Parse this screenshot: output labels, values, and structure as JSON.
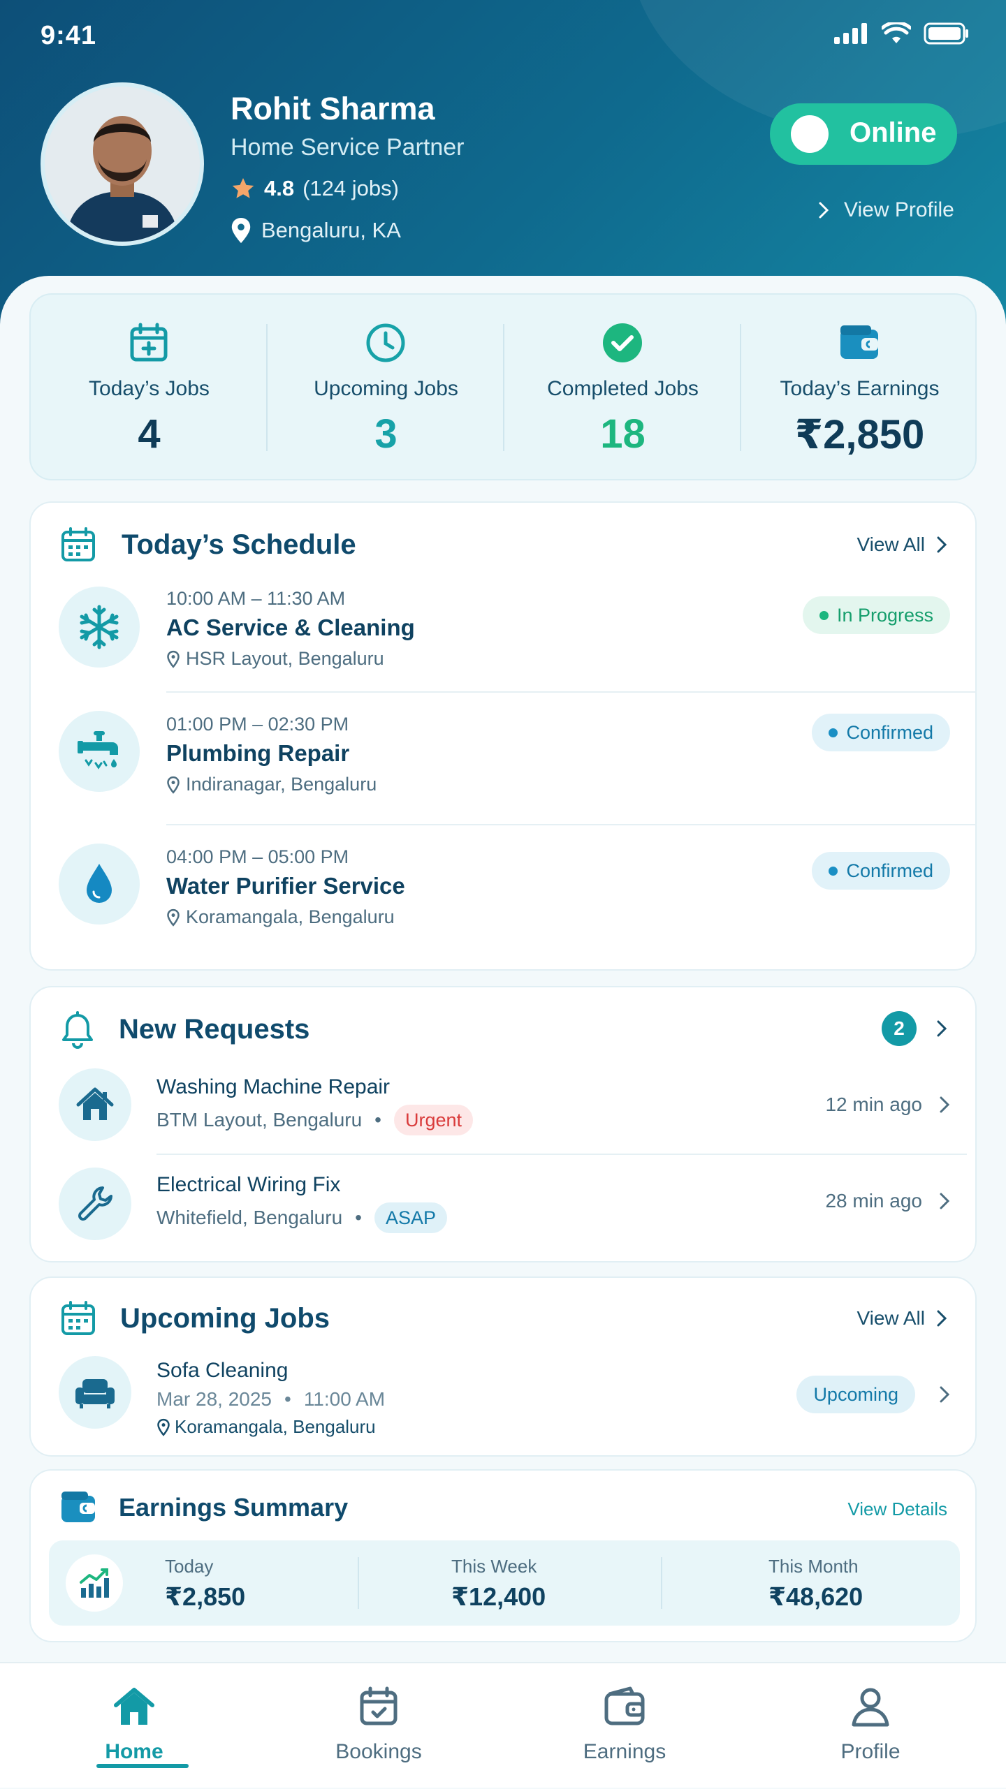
{
  "status_bar": {
    "time": "9:41"
  },
  "profile": {
    "name": "Rohit Sharma",
    "role": "Home Service Partner",
    "rating": "4.8",
    "jobs": "(124 jobs)",
    "location": "Bengaluru, KA",
    "status_toggle": "Online",
    "view_profile": "View Profile"
  },
  "stats": [
    {
      "label": "Today’s Jobs",
      "value": "4",
      "color": "#0f3b57",
      "icon": "calendar-plus-icon"
    },
    {
      "label": "Upcoming Jobs",
      "value": "3",
      "color": "#17a2a8",
      "icon": "clock-icon"
    },
    {
      "label": "Completed Jobs",
      "value": "18",
      "color": "#1db67f",
      "icon": "check-circle-icon"
    },
    {
      "label": "Today’s Earnings",
      "value": "₹2,850",
      "color": "#0f3b57",
      "icon": "wallet-icon"
    }
  ],
  "schedule": {
    "title": "Today’s Schedule",
    "view_all": "View All",
    "jobs": [
      {
        "time": "10:00 AM – 11:30 AM",
        "title": "AC Service & Cleaning",
        "location": "HSR Layout, Bengaluru",
        "status": "In Progress",
        "icon": "snowflake-icon"
      },
      {
        "time": "01:00 PM – 02:30 PM",
        "title": "Plumbing Repair",
        "location": "Indiranagar, Bengaluru",
        "status": "Confirmed",
        "icon": "faucet-icon"
      },
      {
        "time": "04:00 PM – 05:00 PM",
        "title": "Water Purifier Service",
        "location": "Koramangala, Bengaluru",
        "status": "Confirmed",
        "icon": "water-drop-icon"
      }
    ]
  },
  "requests": {
    "title": "New Requests",
    "count": "2",
    "items": [
      {
        "title": "Washing Machine Repair",
        "location": "BTM Layout, Bengaluru",
        "tag": "Urgent",
        "time": "12 min ago",
        "icon": "home-icon"
      },
      {
        "title": "Electrical Wiring Fix",
        "location": "Whitefield, Bengaluru",
        "tag": "ASAP",
        "time": "28 min ago",
        "icon": "wrench-icon"
      }
    ]
  },
  "upcoming": {
    "title": "Upcoming Jobs",
    "view_all": "View All",
    "job": {
      "title": "Sofa Cleaning",
      "date": "Mar 28, 2025",
      "time": "11:00 AM",
      "location": "Koramangala, Bengaluru",
      "status": "Upcoming",
      "icon": "sofa-icon"
    }
  },
  "earnings": {
    "title": "Earnings Summary",
    "view_details": "View Details",
    "today_label": "Today",
    "today_value": "₹2,850",
    "week_label": "This Week",
    "week_value": "₹12,400",
    "month_label": "This Month",
    "month_value": "₹48,620"
  },
  "nav": [
    {
      "label": "Home",
      "active": true,
      "icon": "home-icon"
    },
    {
      "label": "Bookings",
      "active": false,
      "icon": "calendar-icon"
    },
    {
      "label": "Earnings",
      "active": false,
      "icon": "wallet-icon"
    },
    {
      "label": "Profile",
      "active": false,
      "icon": "user-icon"
    }
  ],
  "colors": {
    "primary": "#0f6a8e",
    "accent": "#22c1a0",
    "teal": "#139aa6",
    "urgent": "#d93b3b"
  }
}
